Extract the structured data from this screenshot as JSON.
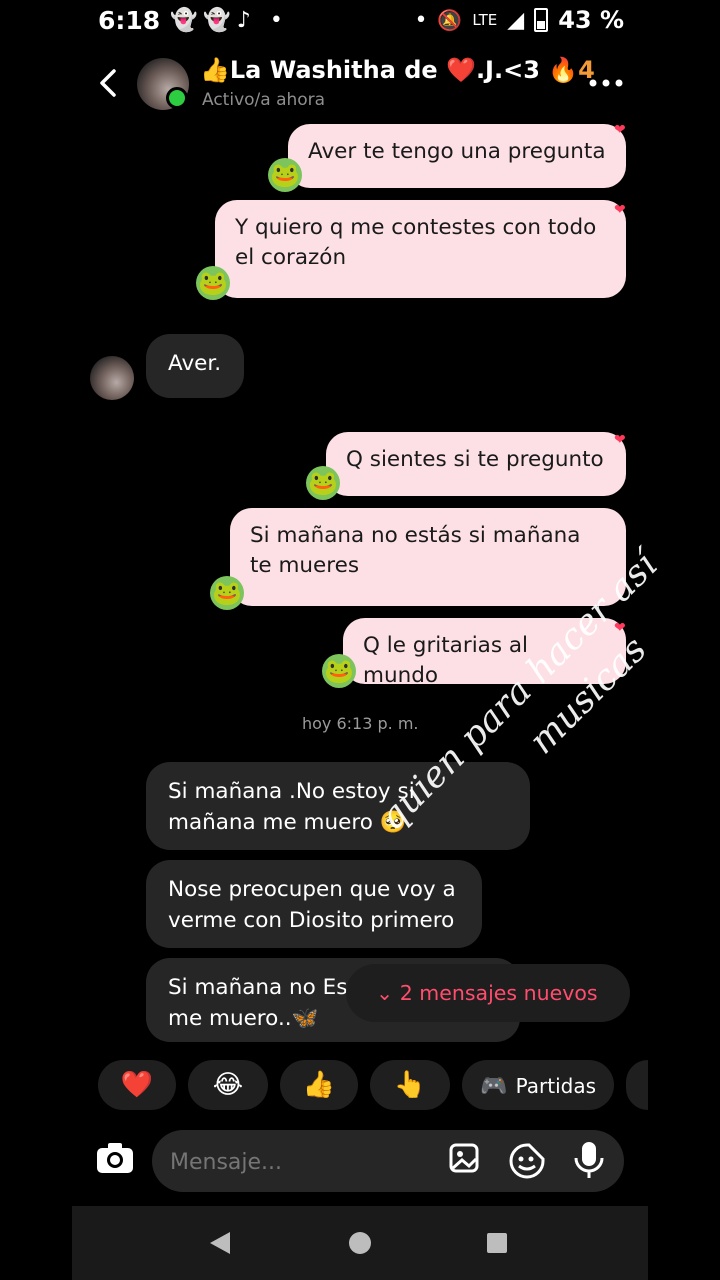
{
  "status_bar": {
    "time": "6:18",
    "network": "LTE",
    "battery": "43 %"
  },
  "header": {
    "back_icon": "chevron-left-icon",
    "name": "👍La Washitha de ❤️.J.<3",
    "streak": "🔥4",
    "presence": "Activo/a ahora",
    "more_icon": "more-dots-icon"
  },
  "messages_out": [
    "Aver te tengo una pregunta",
    "Y quiero q me contestes con todo el corazón"
  ],
  "message_in_1": "Aver.",
  "messages_out_2": [
    "Q sientes si te pregunto",
    "Si mañana no estás si mañana te mueres",
    "Q le gritarias al mundo"
  ],
  "timestamp": "hoy 6:13 p. m.",
  "messages_in": [
    "Si mañana .No estoy si mañana me muero 🥺",
    "Nose preocupen que voy a verme con Diosito primero",
    "Si mañana no Es",
    "me muero..🦋"
  ],
  "new_messages": "2 mensajes nuevos",
  "reactions": [
    "❤️",
    "😂",
    "👍",
    "👆"
  ],
  "games_label": "Partidas",
  "input": {
    "placeholder": "Mensaje..."
  },
  "watermark": [
    "quien para hacer así",
    "musicas"
  ]
}
